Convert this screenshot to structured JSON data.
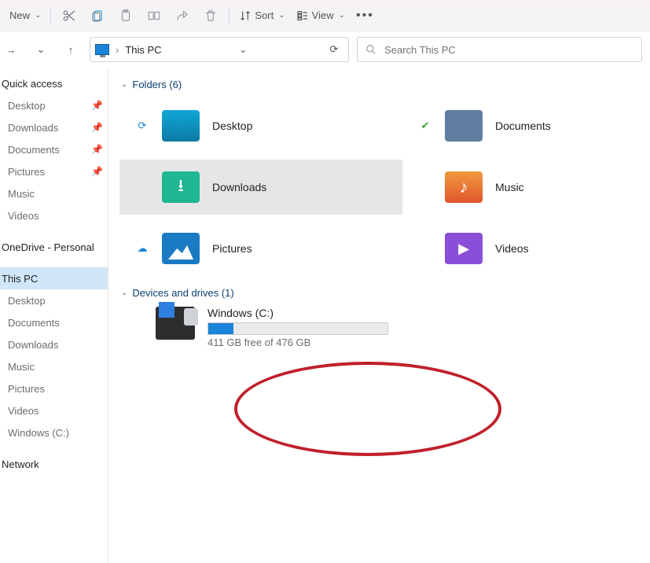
{
  "toolbar": {
    "new_label": "New",
    "sort_label": "Sort",
    "view_label": "View"
  },
  "address": {
    "location": "This PC"
  },
  "search": {
    "placeholder": "Search This PC"
  },
  "sidebar": {
    "quick_access": "Quick access",
    "quick_items": [
      {
        "label": "Desktop",
        "pinned": true
      },
      {
        "label": "Downloads",
        "pinned": true
      },
      {
        "label": "Documents",
        "pinned": true
      },
      {
        "label": "Pictures",
        "pinned": true
      },
      {
        "label": "Music",
        "pinned": false
      },
      {
        "label": "Videos",
        "pinned": false
      }
    ],
    "onedrive": "OneDrive - Personal",
    "this_pc": "This PC",
    "pc_items": [
      {
        "label": "Desktop"
      },
      {
        "label": "Documents"
      },
      {
        "label": "Downloads"
      },
      {
        "label": "Music"
      },
      {
        "label": "Pictures"
      },
      {
        "label": "Videos"
      },
      {
        "label": "Windows (C:)"
      }
    ],
    "network": "Network"
  },
  "sections": {
    "folders_label": "Folders (6)",
    "drives_label": "Devices and drives (1)"
  },
  "folders": [
    {
      "label": "Desktop",
      "status": "sync"
    },
    {
      "label": "Documents",
      "status": "ok"
    },
    {
      "label": "Downloads",
      "status": "",
      "selected": true
    },
    {
      "label": "Music",
      "status": ""
    },
    {
      "label": "Pictures",
      "status": "cloud"
    },
    {
      "label": "Videos",
      "status": ""
    }
  ],
  "drive": {
    "title": "Windows (C:)",
    "free_text": "411 GB free of 476 GB",
    "used_pct": 14
  }
}
